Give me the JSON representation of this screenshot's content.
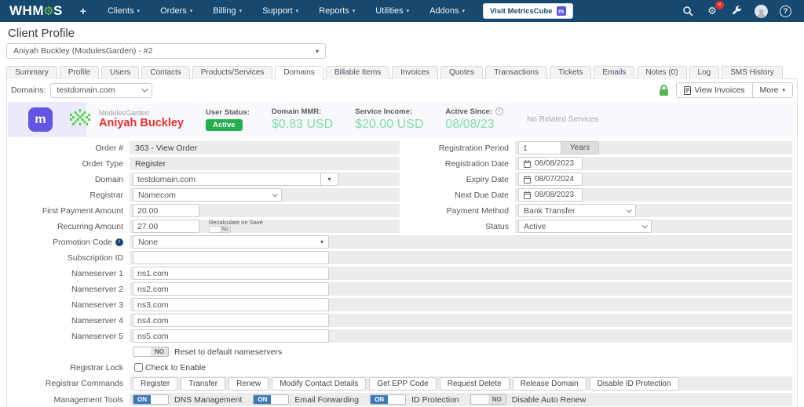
{
  "colors": {
    "navbar_bg": "#17486f",
    "brand_gear_green": "#7dc242",
    "badge_red": "#e03131",
    "client_name_red": "#e03131",
    "active_badge_green": "#25ad4f",
    "money_green": "#7fdfa5",
    "metricscube_purple": "#6156e2",
    "toggle_on_blue": "#3c79b8",
    "row_strip_gray": "#ececec",
    "banner_lavender": "#eceafc"
  },
  "icons": {
    "caret_down": "▾",
    "gear": "⚙",
    "plus": "+",
    "badge": "×",
    "question": "?",
    "info": "i"
  },
  "navbar": {
    "brand": {
      "part1": "WHM",
      "part2": "S"
    },
    "menus": [
      "Clients",
      "Orders",
      "Billing",
      "Support",
      "Reports",
      "Utilities",
      "Addons"
    ],
    "visit_button": {
      "label": "Visit MetricsCube",
      "icon_letter": "m"
    }
  },
  "page": {
    "title": "Client Profile",
    "client_selector": "Aniyah Buckley (ModulesGarden) - #2"
  },
  "tabs": [
    "Summary",
    "Profile",
    "Users",
    "Contacts",
    "Products/Services",
    "Domains",
    "Billable Items",
    "Invoices",
    "Quotes",
    "Transactions",
    "Tickets",
    "Emails",
    "Notes (0)",
    "Log",
    "SMS History"
  ],
  "domain_bar": {
    "label": "Domains:",
    "selected_domain": "testdomain.com",
    "view_invoices": "View Invoices",
    "more": "More"
  },
  "banner": {
    "logo_letter": "m",
    "company": "ModulesGarden",
    "client_name": "Aniyah Buckley",
    "user_status_label": "User Status:",
    "user_status_value": "Active",
    "mrr_label": "Domain MMR:",
    "mrr_value": "$0.83 USD",
    "income_label": "Service Income:",
    "income_value": "$20.00 USD",
    "since_label": "Active Since:",
    "since_value": "08/08/23",
    "related_services": "No Related Services"
  },
  "form": {
    "order_num": {
      "label": "Order #",
      "value": "363 - View Order"
    },
    "order_type": {
      "label": "Order Type",
      "value": "Register"
    },
    "domain": {
      "label": "Domain",
      "value": "testdomain.com"
    },
    "registrar": {
      "label": "Registrar",
      "value": "Namecom"
    },
    "first_payment": {
      "label": "First Payment Amount",
      "value": "20.00"
    },
    "recurring": {
      "label": "Recurring Amount",
      "value": "27.00",
      "recalc_label": "Recalculate on Save",
      "recalc_state": "No"
    },
    "promotion": {
      "label": "Promotion Code",
      "value": "None"
    },
    "subscription": {
      "label": "Subscription ID",
      "value": ""
    },
    "nameservers": [
      {
        "label": "Nameserver 1",
        "value": "ns1.com"
      },
      {
        "label": "Nameserver 2",
        "value": "ns2.com"
      },
      {
        "label": "Nameserver 3",
        "value": "ns3.com"
      },
      {
        "label": "Nameserver 4",
        "value": "ns4.com"
      },
      {
        "label": "Nameserver 5",
        "value": "ns5.com"
      }
    ],
    "reset_ns": {
      "state": "NO",
      "label": "Reset to default nameservers"
    },
    "registrar_lock": {
      "label": "Registrar Lock",
      "checkbox_label": "Check to Enable"
    },
    "registrar_commands": {
      "label": "Registrar Commands",
      "buttons": [
        "Register",
        "Transfer",
        "Renew",
        "Modify Contact Details",
        "Get EPP Code",
        "Request Delete",
        "Release Domain",
        "Disable ID Protection"
      ]
    },
    "management_tools": {
      "label": "Management Tools",
      "toggles": [
        {
          "state": "ON",
          "label": "DNS Management"
        },
        {
          "state": "ON",
          "label": "Email Forwarding"
        },
        {
          "state": "ON",
          "label": "ID Protection"
        },
        {
          "state": "NO",
          "label": "Disable Auto Renew"
        }
      ]
    },
    "registration_period": {
      "label": "Registration Period",
      "value": "1",
      "addon": "Years"
    },
    "registration_date": {
      "label": "Registration Date",
      "value": "08/08/2023"
    },
    "expiry_date": {
      "label": "Expiry Date",
      "value": "08/07/2024"
    },
    "next_due_date": {
      "label": "Next Due Date",
      "value": "08/08/2023"
    },
    "payment_method": {
      "label": "Payment Method",
      "value": "Bank Transfer"
    },
    "status": {
      "label": "Status",
      "value": "Active"
    }
  }
}
